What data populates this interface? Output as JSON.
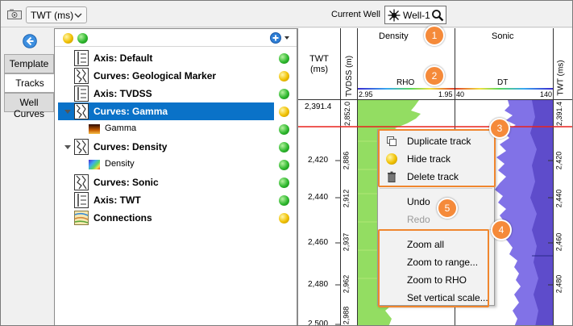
{
  "toolbar": {
    "units_value": "TWT (ms)",
    "current_well_label": "Current Well",
    "well_name": "Well-1"
  },
  "tabs": [
    {
      "label": "Template",
      "active": false
    },
    {
      "label": "Tracks",
      "active": true
    },
    {
      "label": "Well Curves",
      "active": false
    }
  ],
  "tree": {
    "header_status": [
      "yellow",
      "green"
    ],
    "items": [
      {
        "label": "Axis: Default",
        "icon": "axis-track-icon",
        "status": "green",
        "level": 0
      },
      {
        "label": "Curves: Geological Marker",
        "icon": "curve-track-icon",
        "status": "yellow",
        "level": 0
      },
      {
        "label": "Axis: TVDSS",
        "icon": "axis-track-icon",
        "status": "green",
        "level": 0
      },
      {
        "label": "Curves: Gamma",
        "icon": "curve-track-icon",
        "status": "yellow",
        "level": 0,
        "selected": true,
        "expanded": true
      },
      {
        "label": "Gamma",
        "icon": "gamma-colormap-swatch",
        "status": "green",
        "level": 1
      },
      {
        "label": "Curves: Density",
        "icon": "curve-track-icon",
        "status": "green",
        "level": 0,
        "expanded": true
      },
      {
        "label": "Density",
        "icon": "density-colormap-swatch",
        "status": "green",
        "level": 1
      },
      {
        "label": "Curves: Sonic",
        "icon": "curve-track-icon",
        "status": "green",
        "level": 0
      },
      {
        "label": "Axis: TWT",
        "icon": "axis-track-icon",
        "status": "green",
        "level": 0
      },
      {
        "label": "Connections",
        "icon": "connections-icon",
        "status": "yellow",
        "level": 0
      }
    ]
  },
  "log_view": {
    "twt_header": "TWT\n(ms)",
    "tvdss_header": "TVDSS (m)",
    "twt_right_header": "TWT (ms)",
    "density_track": {
      "title": "Density",
      "curve": "RHO",
      "scale_min": "2.95",
      "scale_max": "1.95"
    },
    "sonic_track": {
      "title": "Sonic",
      "curve": "DT",
      "scale_min": "40",
      "scale_max": "140"
    },
    "top_value_twt": "2,391.4",
    "top_value_tvdss": "2,852.0",
    "top_value_twt_right": "2,391.4",
    "twt_ticks": [
      "2,420",
      "2,440",
      "2,460",
      "2,480",
      "2,500"
    ],
    "tvdss_ticks": [
      "2,886",
      "2,912",
      "2,937",
      "2,962",
      "2,988"
    ],
    "colors": {
      "marker_line": "#e8231e",
      "density_fill": "#7dd04f",
      "sonic_fill": "#6a5ad6",
      "selection": "#0a72c8",
      "callout": "#f58a3a"
    }
  },
  "context_menu": {
    "items": [
      {
        "label": "Duplicate track",
        "icon": "duplicate-icon",
        "enabled": true
      },
      {
        "label": "Hide track",
        "icon": "hide-dot-icon",
        "enabled": true
      },
      {
        "label": "Delete track",
        "icon": "trash-icon",
        "enabled": true
      },
      {
        "label": "Undo",
        "enabled": true
      },
      {
        "label": "Redo",
        "enabled": false
      },
      {
        "label": "Zoom all",
        "enabled": true
      },
      {
        "label": "Zoom to range...",
        "enabled": true
      },
      {
        "label": "Zoom to RHO",
        "enabled": true
      },
      {
        "label": "Set vertical scale...",
        "enabled": true
      }
    ]
  },
  "callouts": [
    "1",
    "2",
    "3",
    "4",
    "5"
  ]
}
